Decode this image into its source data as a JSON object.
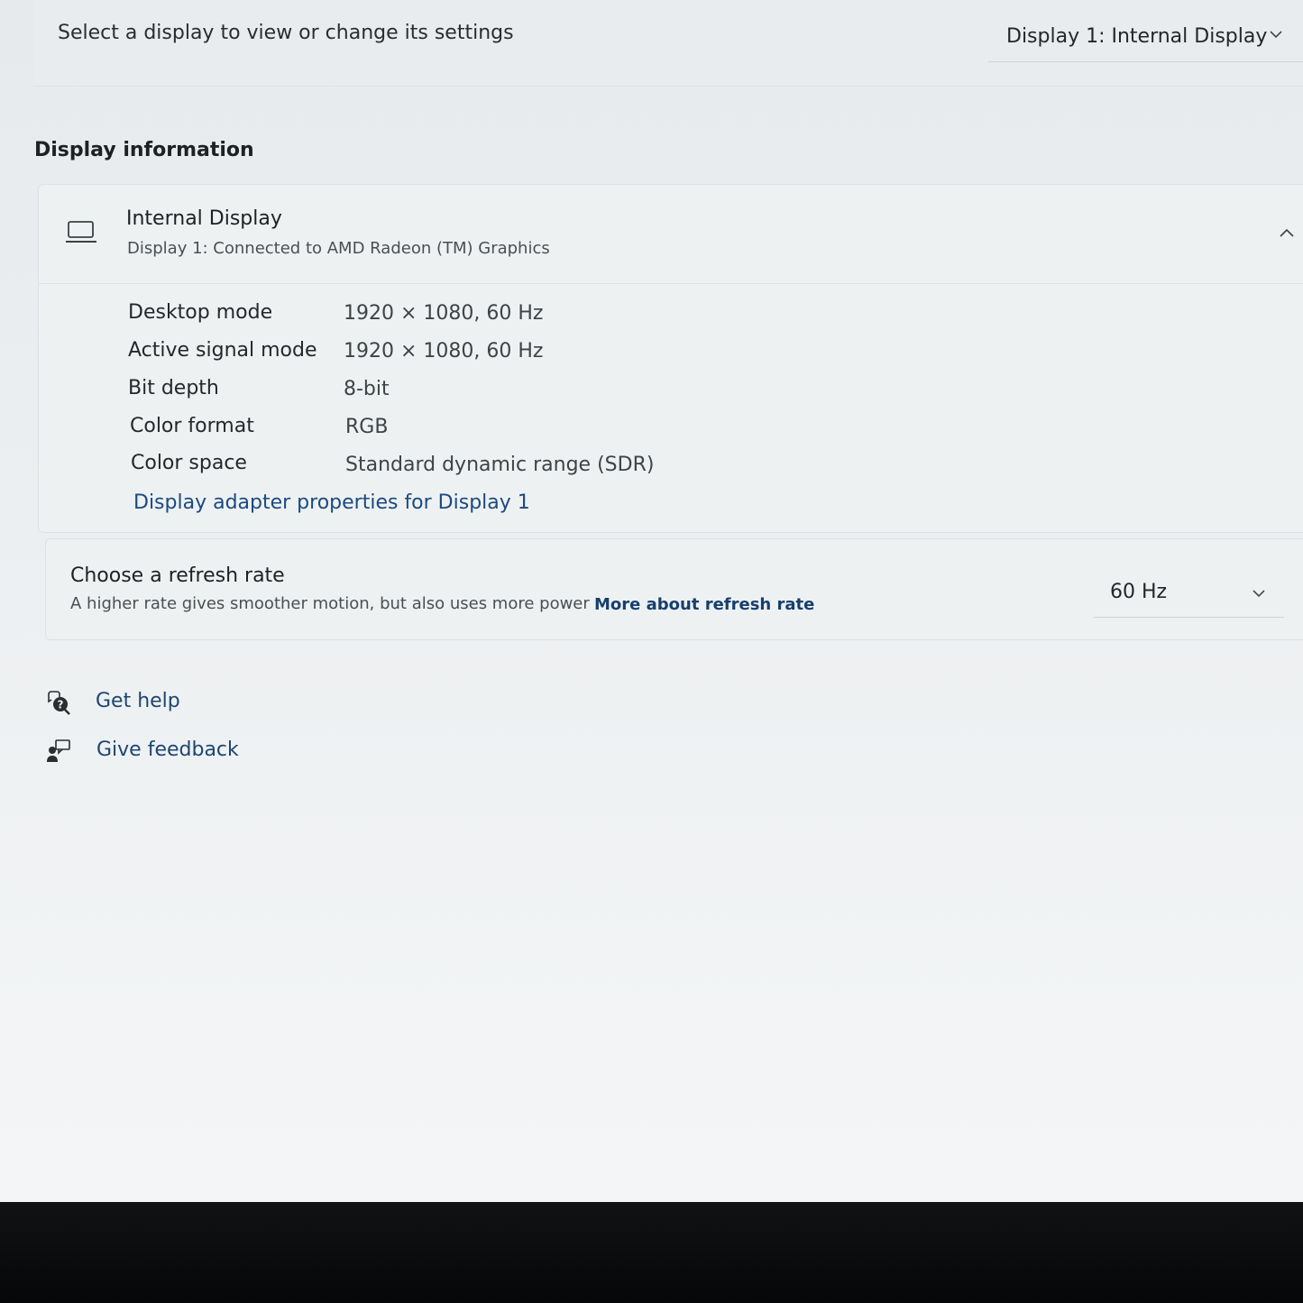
{
  "display_selector": {
    "prompt": "Select a display to view or change its settings",
    "selected": "Display 1: Internal Display"
  },
  "display_information": {
    "heading": "Display information",
    "device_name": "Internal Display",
    "device_subtitle": "Display 1: Connected to AMD Radeon (TM) Graphics",
    "rows": [
      {
        "label": "Desktop mode",
        "value": "1920 × 1080, 60 Hz"
      },
      {
        "label": "Active signal mode",
        "value": "1920 × 1080, 60 Hz"
      },
      {
        "label": "Bit depth",
        "value": "8-bit"
      },
      {
        "label": "Color format",
        "value": "RGB"
      },
      {
        "label": "Color space",
        "value": "Standard dynamic range (SDR)"
      }
    ],
    "adapter_link": "Display adapter properties for Display 1"
  },
  "refresh_rate": {
    "title": "Choose a refresh rate",
    "description": "A higher rate gives smoother motion, but also uses more power",
    "link": "More about refresh rate",
    "selected": "60 Hz"
  },
  "help": {
    "get_help": "Get help",
    "give_feedback": "Give feedback"
  },
  "icons": {
    "display": "laptop-icon",
    "collapse": "chevron-up-icon",
    "dropdown": "chevron-down-icon",
    "help": "help-icon",
    "feedback": "feedback-icon"
  },
  "colors": {
    "link": "#1a4a80",
    "card_bg": "#eef1f2",
    "page_bg": "#eceff1"
  }
}
